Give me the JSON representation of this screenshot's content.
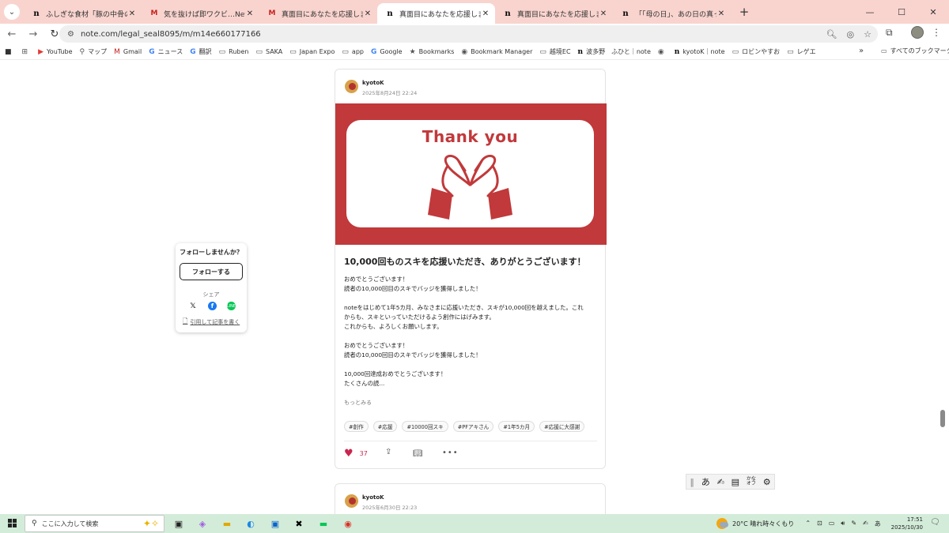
{
  "browser": {
    "tabs": [
      {
        "favicon": "n",
        "title": "ふしぎな食材「豚の中骨の缶詰」",
        "active": false
      },
      {
        "favicon": "M",
        "title": "気を抜けば即ワクビ…Netflixで学んだ",
        "active": false
      },
      {
        "favicon": "M",
        "title": "真面目にあなたを応援しますね💖(",
        "active": false
      },
      {
        "favicon": "n",
        "title": "真面目にあなたを応援しますね💖(",
        "active": true
      },
      {
        "favicon": "n",
        "title": "真面目にあなたを応援しますね💖(",
        "active": false
      },
      {
        "favicon": "n",
        "title": "「「母の日」、あの日の真っ赤な",
        "active": false
      }
    ],
    "new_tab_icon": "+",
    "window_controls": {
      "minimize": "—",
      "maximize": "☐",
      "close": "✕"
    },
    "url": "note.com/legal_seal8095/m/m14e660177166",
    "bookmarks": [
      {
        "icon": "apps-icon",
        "glyph": "⊞",
        "label": ""
      },
      {
        "icon": "youtube-icon",
        "glyph": "▶",
        "label": "YouTube"
      },
      {
        "icon": "maps-icon",
        "glyph": "⚲",
        "label": "マップ"
      },
      {
        "icon": "gmail-icon",
        "glyph": "M",
        "label": "Gmail"
      },
      {
        "icon": "news-icon",
        "glyph": "G",
        "label": "ニュース"
      },
      {
        "icon": "translate-icon",
        "glyph": "G",
        "label": "翻訳"
      },
      {
        "icon": "folder-icon",
        "glyph": "▭",
        "label": "Ruben"
      },
      {
        "icon": "folder-icon",
        "glyph": "▭",
        "label": "SAKA"
      },
      {
        "icon": "folder-icon",
        "glyph": "▭",
        "label": "Japan Expo"
      },
      {
        "icon": "folder-icon",
        "glyph": "▭",
        "label": "app"
      },
      {
        "icon": "google-icon",
        "glyph": "G",
        "label": "Google"
      },
      {
        "icon": "star-icon",
        "glyph": "★",
        "label": "Bookmarks"
      },
      {
        "icon": "globe-icon",
        "glyph": "◉",
        "label": "Bookmark Manager"
      },
      {
        "icon": "folder-icon",
        "glyph": "▭",
        "label": "越境EC"
      },
      {
        "icon": "note-icon",
        "glyph": "n",
        "label": "波多野　ふひと｜note"
      },
      {
        "icon": "globe-icon",
        "glyph": "◉",
        "label": ""
      },
      {
        "icon": "note-icon",
        "glyph": "n",
        "label": "kyotoK｜note"
      },
      {
        "icon": "folder-icon",
        "glyph": "▭",
        "label": "ロビンやすお"
      },
      {
        "icon": "folder-icon",
        "glyph": "▭",
        "label": "レゲエ"
      }
    ],
    "bookmarks_more": "»",
    "all_bookmarks": "すべてのブックマーク"
  },
  "follow_box": {
    "question": "フォローしませんか？",
    "follow_label": "フォローする",
    "share_label": "シェア",
    "quote_label": "引用して記事を書く"
  },
  "post": {
    "author": "kyotoK",
    "date": "2025年8月24日 22:24",
    "hero_text": "Thank you",
    "headline": "10,000回ものスキを応援いただき、ありがとうございます！",
    "body": [
      "おめでとうございます！",
      "読者の10,000回目のスキでバッジを獲得しました！",
      "",
      "noteをはじめて1年5カ月、みなさまに応援いただき、スキが10,000回を越えました。これ",
      "からも、スキといっていただけるよう創作にはげみます。",
      "これからも、よろしくお願いします。",
      "",
      "おめでとうございます！",
      "読者の10,000回目のスキでバッジを獲得しました！",
      "",
      "10,000回達成おめでとうございます！",
      "たくさんの読..."
    ],
    "read_more": "もっとみる",
    "tags": [
      "#創作",
      "#応援",
      "#10000回スキ",
      "#PFアキさん",
      "#1年5カ月",
      "#応援に大感謝"
    ],
    "like_count": "37"
  },
  "next_post": {
    "author": "kyotoK",
    "date": "2025年6月30日 22:23"
  },
  "ime": {
    "kana": "あ",
    "kana_toggle": "かな\nオフ"
  },
  "taskbar": {
    "search_placeholder": "ここに入力して検索",
    "weather": "20°C  晴れ時々くもり",
    "ime_indicator": "あ",
    "time": "17:51",
    "date": "2025/10/30"
  },
  "colors": {
    "tabstrip": "#f9d4cf",
    "hero_red": "#c1393b",
    "like_pink": "#c8264e",
    "taskbar": "#d3ecd9"
  }
}
